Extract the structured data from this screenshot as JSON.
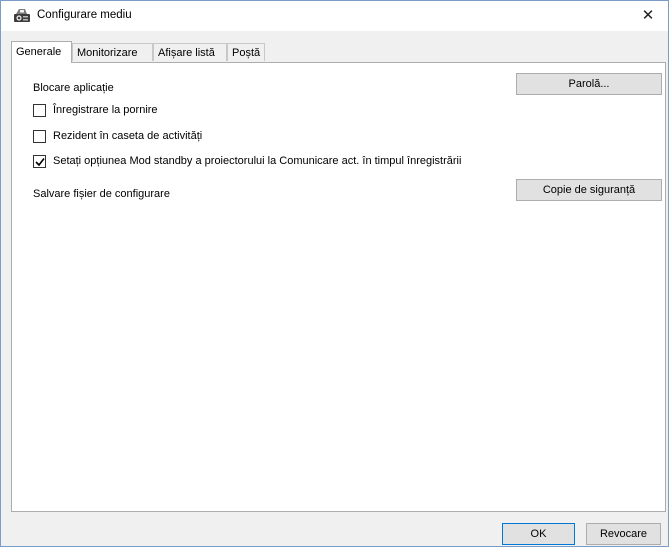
{
  "window": {
    "title": "Configurare mediu",
    "close_glyph": "✕"
  },
  "tabs": [
    {
      "label": "Generale",
      "active": true
    },
    {
      "label": "Monitorizare",
      "active": false
    },
    {
      "label": "Afișare listă",
      "active": false
    },
    {
      "label": "Poștă",
      "active": false
    }
  ],
  "general": {
    "lock_label": "Blocare aplicație",
    "password_button": "Parolă...",
    "checkboxes": [
      {
        "label": "Înregistrare la pornire",
        "checked": false
      },
      {
        "label": "Rezident în caseta de activități",
        "checked": false
      },
      {
        "label": "Setați opțiunea Mod standby a proiectorului la Comunicare act. în timpul înregistrării",
        "checked": true
      }
    ],
    "save_config_label": "Salvare fișier de configurare",
    "backup_button": "Copie de siguranță"
  },
  "footer": {
    "ok_label": "OK",
    "cancel_label": "Revocare"
  },
  "icons": {
    "app": "projector-settings-icon",
    "close": "close-icon",
    "check": "checkmark-icon"
  },
  "colors": {
    "window_border": "#7a9cc6",
    "ok_border": "#0078d7"
  }
}
